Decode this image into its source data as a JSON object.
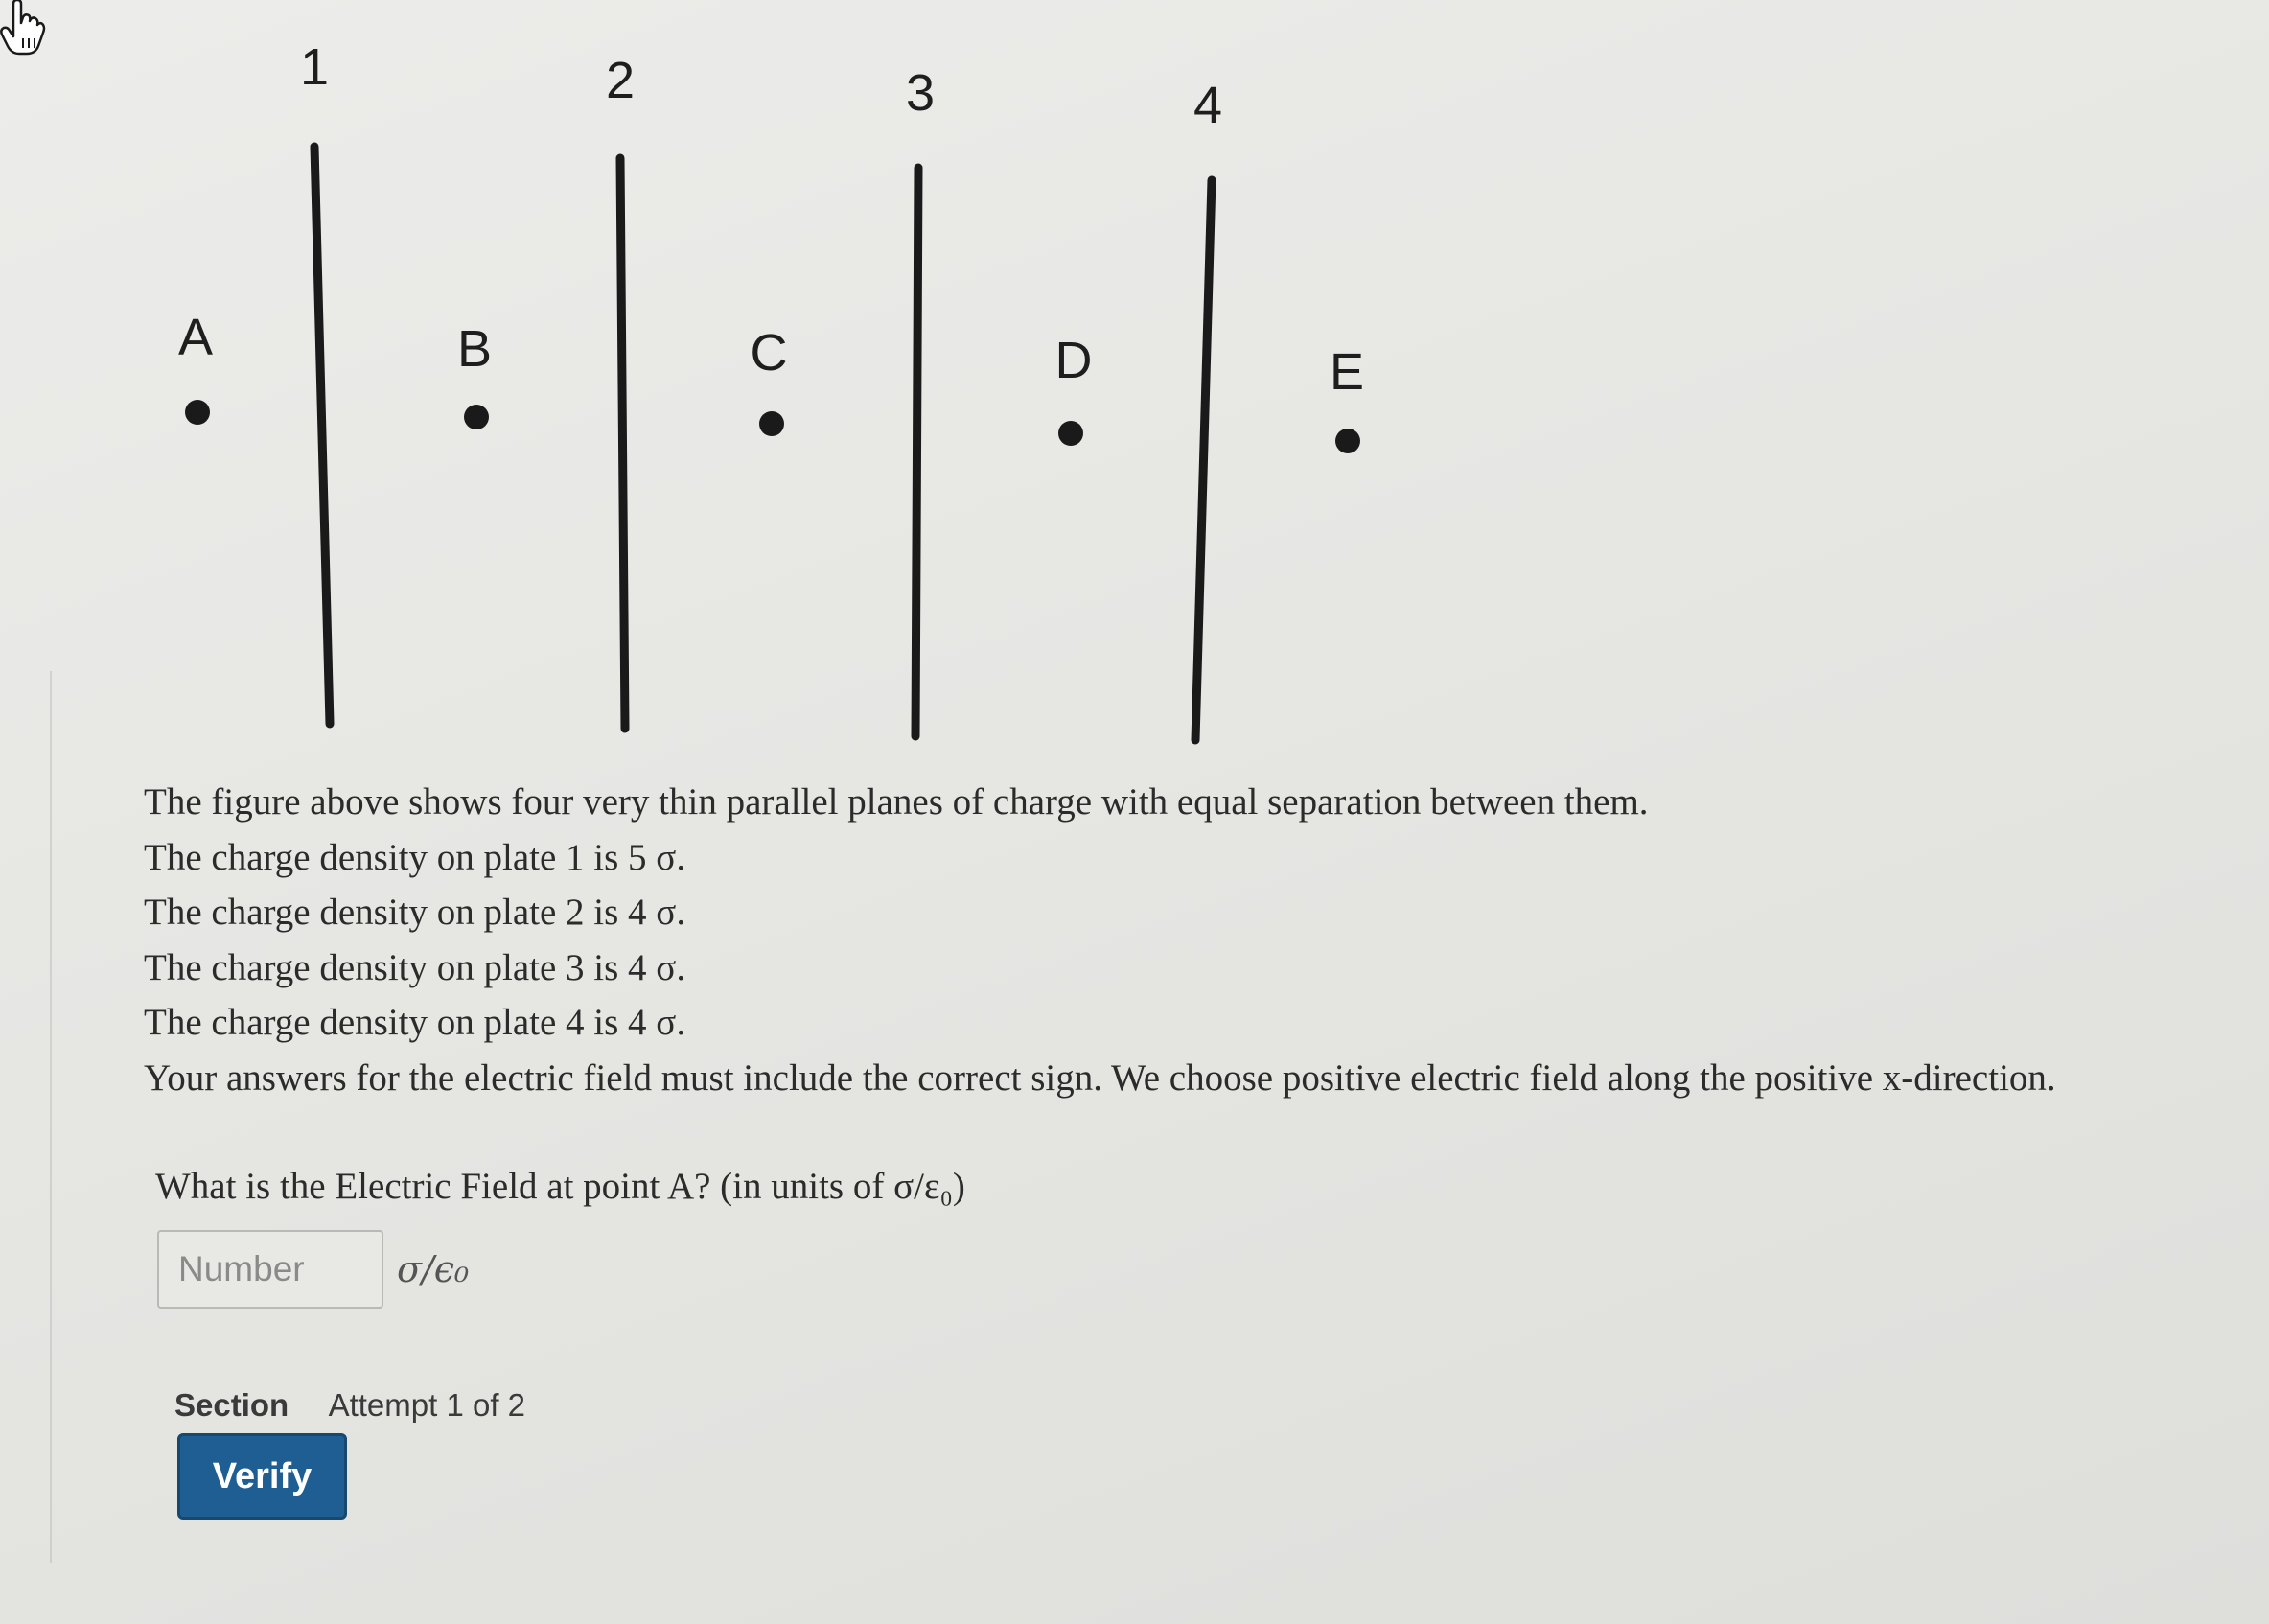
{
  "figure": {
    "plate_numbers": [
      "1",
      "2",
      "3",
      "4"
    ],
    "point_labels": [
      "A",
      "B",
      "C",
      "D",
      "E"
    ]
  },
  "problem": {
    "lines": [
      "The figure above shows four very thin parallel planes of charge with equal separation between them.",
      "The charge density on plate 1 is 5 σ.",
      "The charge density on plate 2 is 4 σ.",
      "The charge density on plate 3 is 4 σ.",
      "The charge density on plate 4 is 4 σ.",
      "Your answers for the electric field must include the correct sign. We choose positive electric field along the positive x-direction."
    ]
  },
  "question": {
    "text": "What is the Electric Field at point A? (in units of σ/ε₀)",
    "input_placeholder": "Number",
    "input_value": "",
    "unit": "σ/ϵ₀"
  },
  "section": {
    "label": "Section",
    "attempt": "Attempt 1 of 2"
  },
  "actions": {
    "verify_label": "Verify"
  },
  "icons": {
    "cursor": "hand-pointer-icon"
  }
}
